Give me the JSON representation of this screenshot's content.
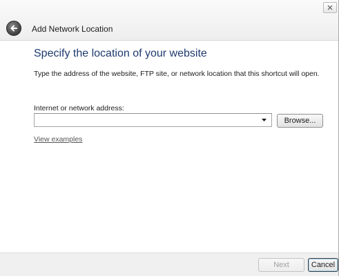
{
  "window": {
    "title": "Add Network Location",
    "close_icon": "close-icon",
    "back_icon": "back-arrow-icon"
  },
  "content": {
    "heading": "Specify the location of your website",
    "description": "Type the address of the website, FTP site, or network location that this shortcut will open.",
    "address_label": "Internet or network address:",
    "address_value": "",
    "address_placeholder": "",
    "dropdown_icon": "chevron-down-icon",
    "browse_label": "Browse...",
    "view_examples_label": "View examples"
  },
  "footer": {
    "next_label": "Next",
    "next_enabled": false,
    "cancel_label": "Cancel"
  },
  "colors": {
    "heading": "#1e3a6e",
    "footer_bg": "#f0f0f0"
  }
}
